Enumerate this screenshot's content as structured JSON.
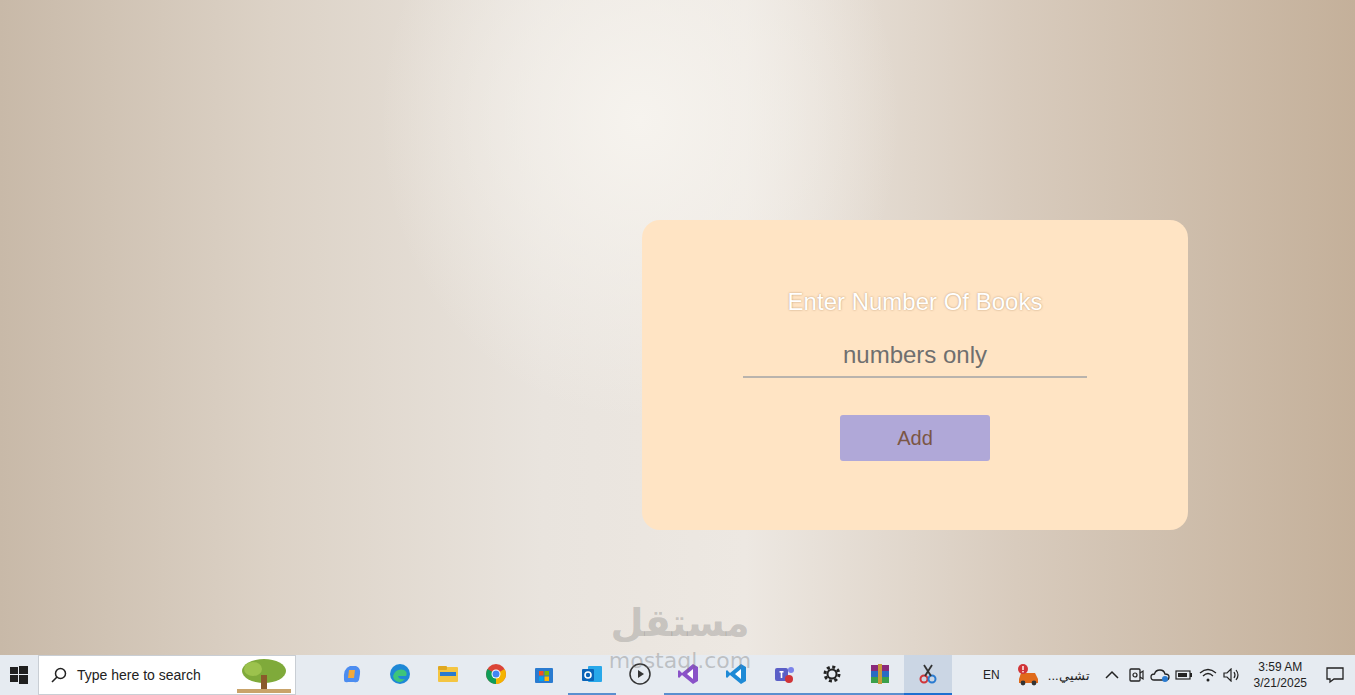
{
  "form": {
    "title": "Enter Number Of Books",
    "field": {
      "placeholder": "numbers only",
      "value": ""
    },
    "button": "Add"
  },
  "watermark": {
    "arabic": "مستقل",
    "latin": "mostaql.com"
  },
  "taskbar": {
    "search": {
      "placeholder": "Type here to search"
    },
    "apps": [
      {
        "running": false,
        "active": false
      },
      {
        "running": false,
        "active": false
      },
      {
        "running": false,
        "active": false
      },
      {
        "running": false,
        "active": false
      },
      {
        "running": false,
        "active": false
      },
      {
        "running": true,
        "active": false
      },
      {
        "running": false,
        "active": false
      },
      {
        "running": true,
        "active": false
      },
      {
        "running": true,
        "active": false
      },
      {
        "running": true,
        "active": false
      },
      {
        "running": true,
        "active": false
      },
      {
        "running": true,
        "active": false
      },
      {
        "running": true,
        "active": true
      }
    ],
    "language": "EN",
    "notification": {
      "text": "تشيي..."
    },
    "clock": {
      "time": "3:59 AM",
      "date": "3/21/2025"
    }
  }
}
